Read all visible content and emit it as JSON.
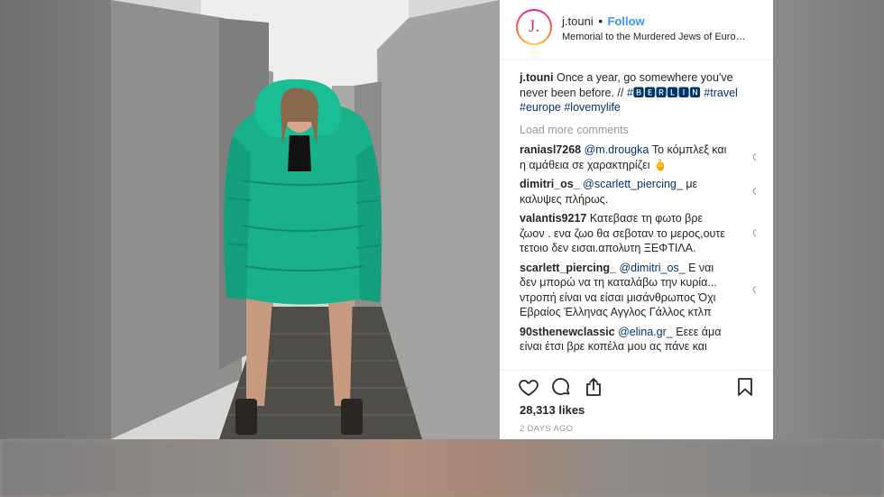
{
  "post": {
    "username": "j.touni",
    "follow_label": "Follow",
    "separator": "•",
    "location": "Memorial to the Murdered Jews of Euro…",
    "avatar_letter": "J."
  },
  "caption": {
    "username": "j.touni",
    "text": "Once a year, go somewhere you've never been before. //",
    "tags": [
      "#🅱🅴🆁🅻🅸🅽",
      "#travel",
      "#europe",
      "#lovemylife"
    ]
  },
  "load_more_label": "Load more comments",
  "comments": [
    {
      "username": "raniasl7268",
      "mention": "@m.drougka",
      "text": "Το κόμπλεξ και η αμάθεια σε χαρακτηρίζει 🖕"
    },
    {
      "username": "dimitri_os_",
      "mention": "@scarlett_piercing_",
      "text": "με καλυψες πλήρως."
    },
    {
      "username": "valantis9217",
      "mention": "",
      "text": "Κατεβασε τη φωτο βρε ζωον . ενα ζωο θα σεβοταν το μερος,ουτε τετοιο δεν εισαι.απολυτη ΞΕΦΤΙΛΑ."
    },
    {
      "username": "scarlett_piercing_",
      "mention": "@dimitri_os_",
      "text": "Ε ναι δεν μπορώ να τη καταλάβω την κυρία... ντροπή είναι να είσαι μισάνθρωπος Όχι Εβραίος Έλληνας Αγγλος Γάλλος κτλπ"
    },
    {
      "username": "90sthenewclassic",
      "mention": "@elina.gr_",
      "text": "Εεεε άμα είναι έτσι βρε κοπέλα μου ας πάνε και"
    }
  ],
  "likes": "28,313 likes",
  "time_ago": "2 DAYS AGO",
  "icons": {
    "like": "heart-icon",
    "comment": "comment-icon",
    "share": "share-icon",
    "save": "bookmark-icon"
  },
  "colors": {
    "follow": "#3897f0",
    "hashtag": "#003569",
    "muted": "#999999",
    "jacket": "#19b08a"
  }
}
